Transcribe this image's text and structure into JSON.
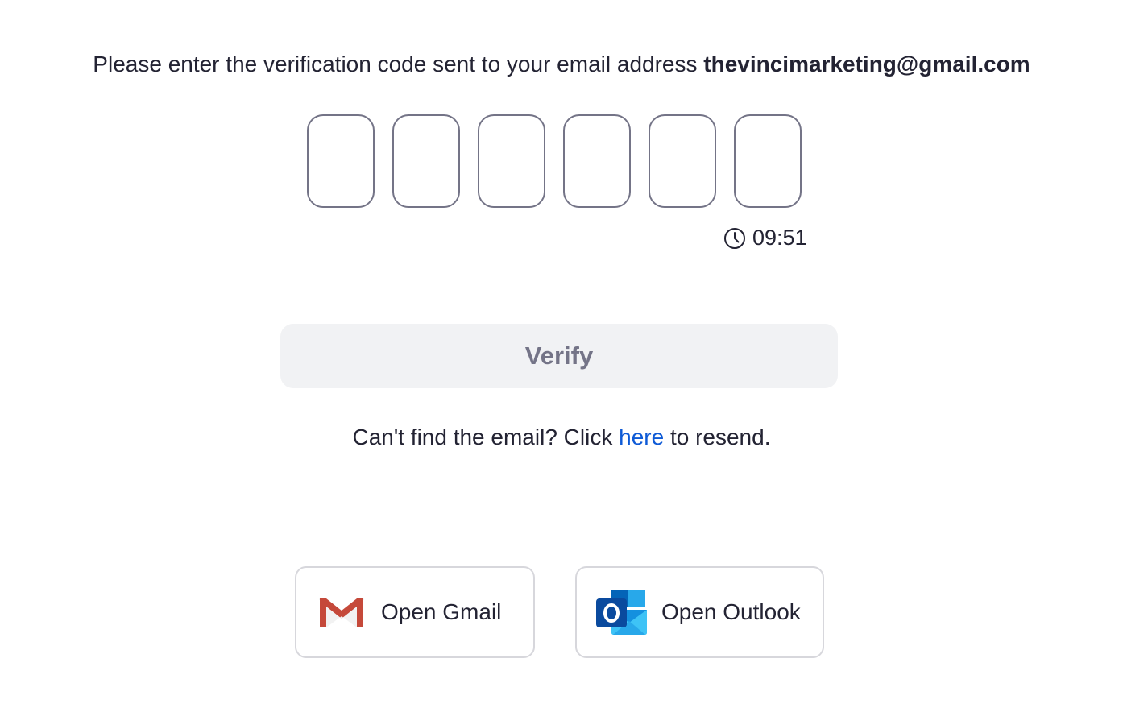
{
  "prompt": {
    "text": "Please enter the verification code sent to your email address",
    "email": "thevincimarketing@gmail.com"
  },
  "code_inputs": [
    {
      "value": ""
    },
    {
      "value": ""
    },
    {
      "value": ""
    },
    {
      "value": ""
    },
    {
      "value": ""
    },
    {
      "value": ""
    }
  ],
  "timer": {
    "icon": "clock-icon",
    "value": "09:51"
  },
  "verify_button": {
    "label": "Verify"
  },
  "resend": {
    "prefix": "Can't find the email? Click",
    "link": "here",
    "suffix": "to resend."
  },
  "mail_buttons": {
    "gmail": {
      "label": "Open Gmail",
      "icon": "gmail-icon"
    },
    "outlook": {
      "label": "Open Outlook",
      "icon": "outlook-icon"
    }
  },
  "colors": {
    "link": "#0e5ad6",
    "text": "#232333",
    "verify_bg": "#f1f2f4",
    "verify_text": "#747487"
  }
}
